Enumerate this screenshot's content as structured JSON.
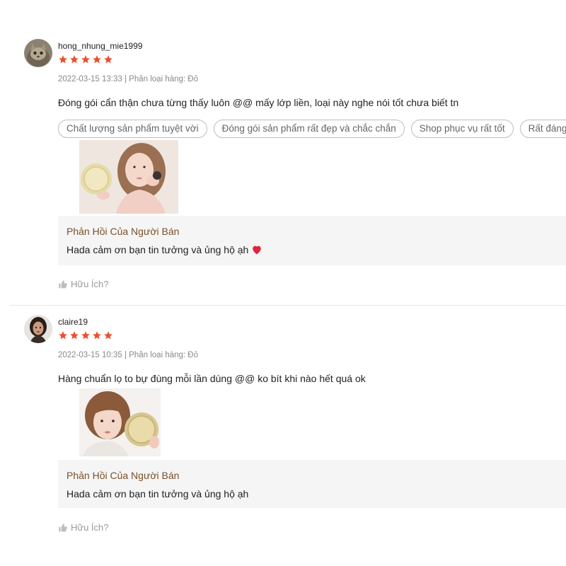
{
  "reviews": [
    {
      "username": "hong_nhung_mie1999",
      "rating": 5,
      "meta": "2022-03-15 13:33 | Phân loại hàng: Đỏ",
      "comment": "Đóng gói cẩn thận chưa từng thấy luôn @@ mấy lớp liền, loại này nghe nói tốt chưa biết tn",
      "tags": [
        "Chất lượng sản phẩm tuyệt vời",
        "Đóng gói sản phẩm rất đẹp và chắc chắn",
        "Shop phục vụ rất tốt",
        "Rất đáng"
      ],
      "reply_title": "Phản Hồi Của Người Bán",
      "reply_text": "Hada cảm ơn bạn tin tưởng và ủng hộ ạh",
      "helpful": "Hữu Ích?"
    },
    {
      "username": "claire19",
      "rating": 5,
      "meta": "2022-03-15 10:35 | Phân loại hàng: Đỏ",
      "comment": "Hàng chuẩn lọ to bự đùng mỗi lần dùng @@ ko bít khi nào hết quá ok",
      "reply_title": "Phản Hồi Của Người Bán",
      "reply_text": "Hada cảm ơn bạn tin tưởng và ủng hộ ạh",
      "helpful": "Hữu Ích?"
    }
  ],
  "colors": {
    "star": "#ee4d2d",
    "reply_title": "#7a4f2a",
    "heart": "#e0243a"
  },
  "icons": {
    "star": "star-icon",
    "thumb": "thumbs-up-icon",
    "heart": "heart-emoji"
  }
}
